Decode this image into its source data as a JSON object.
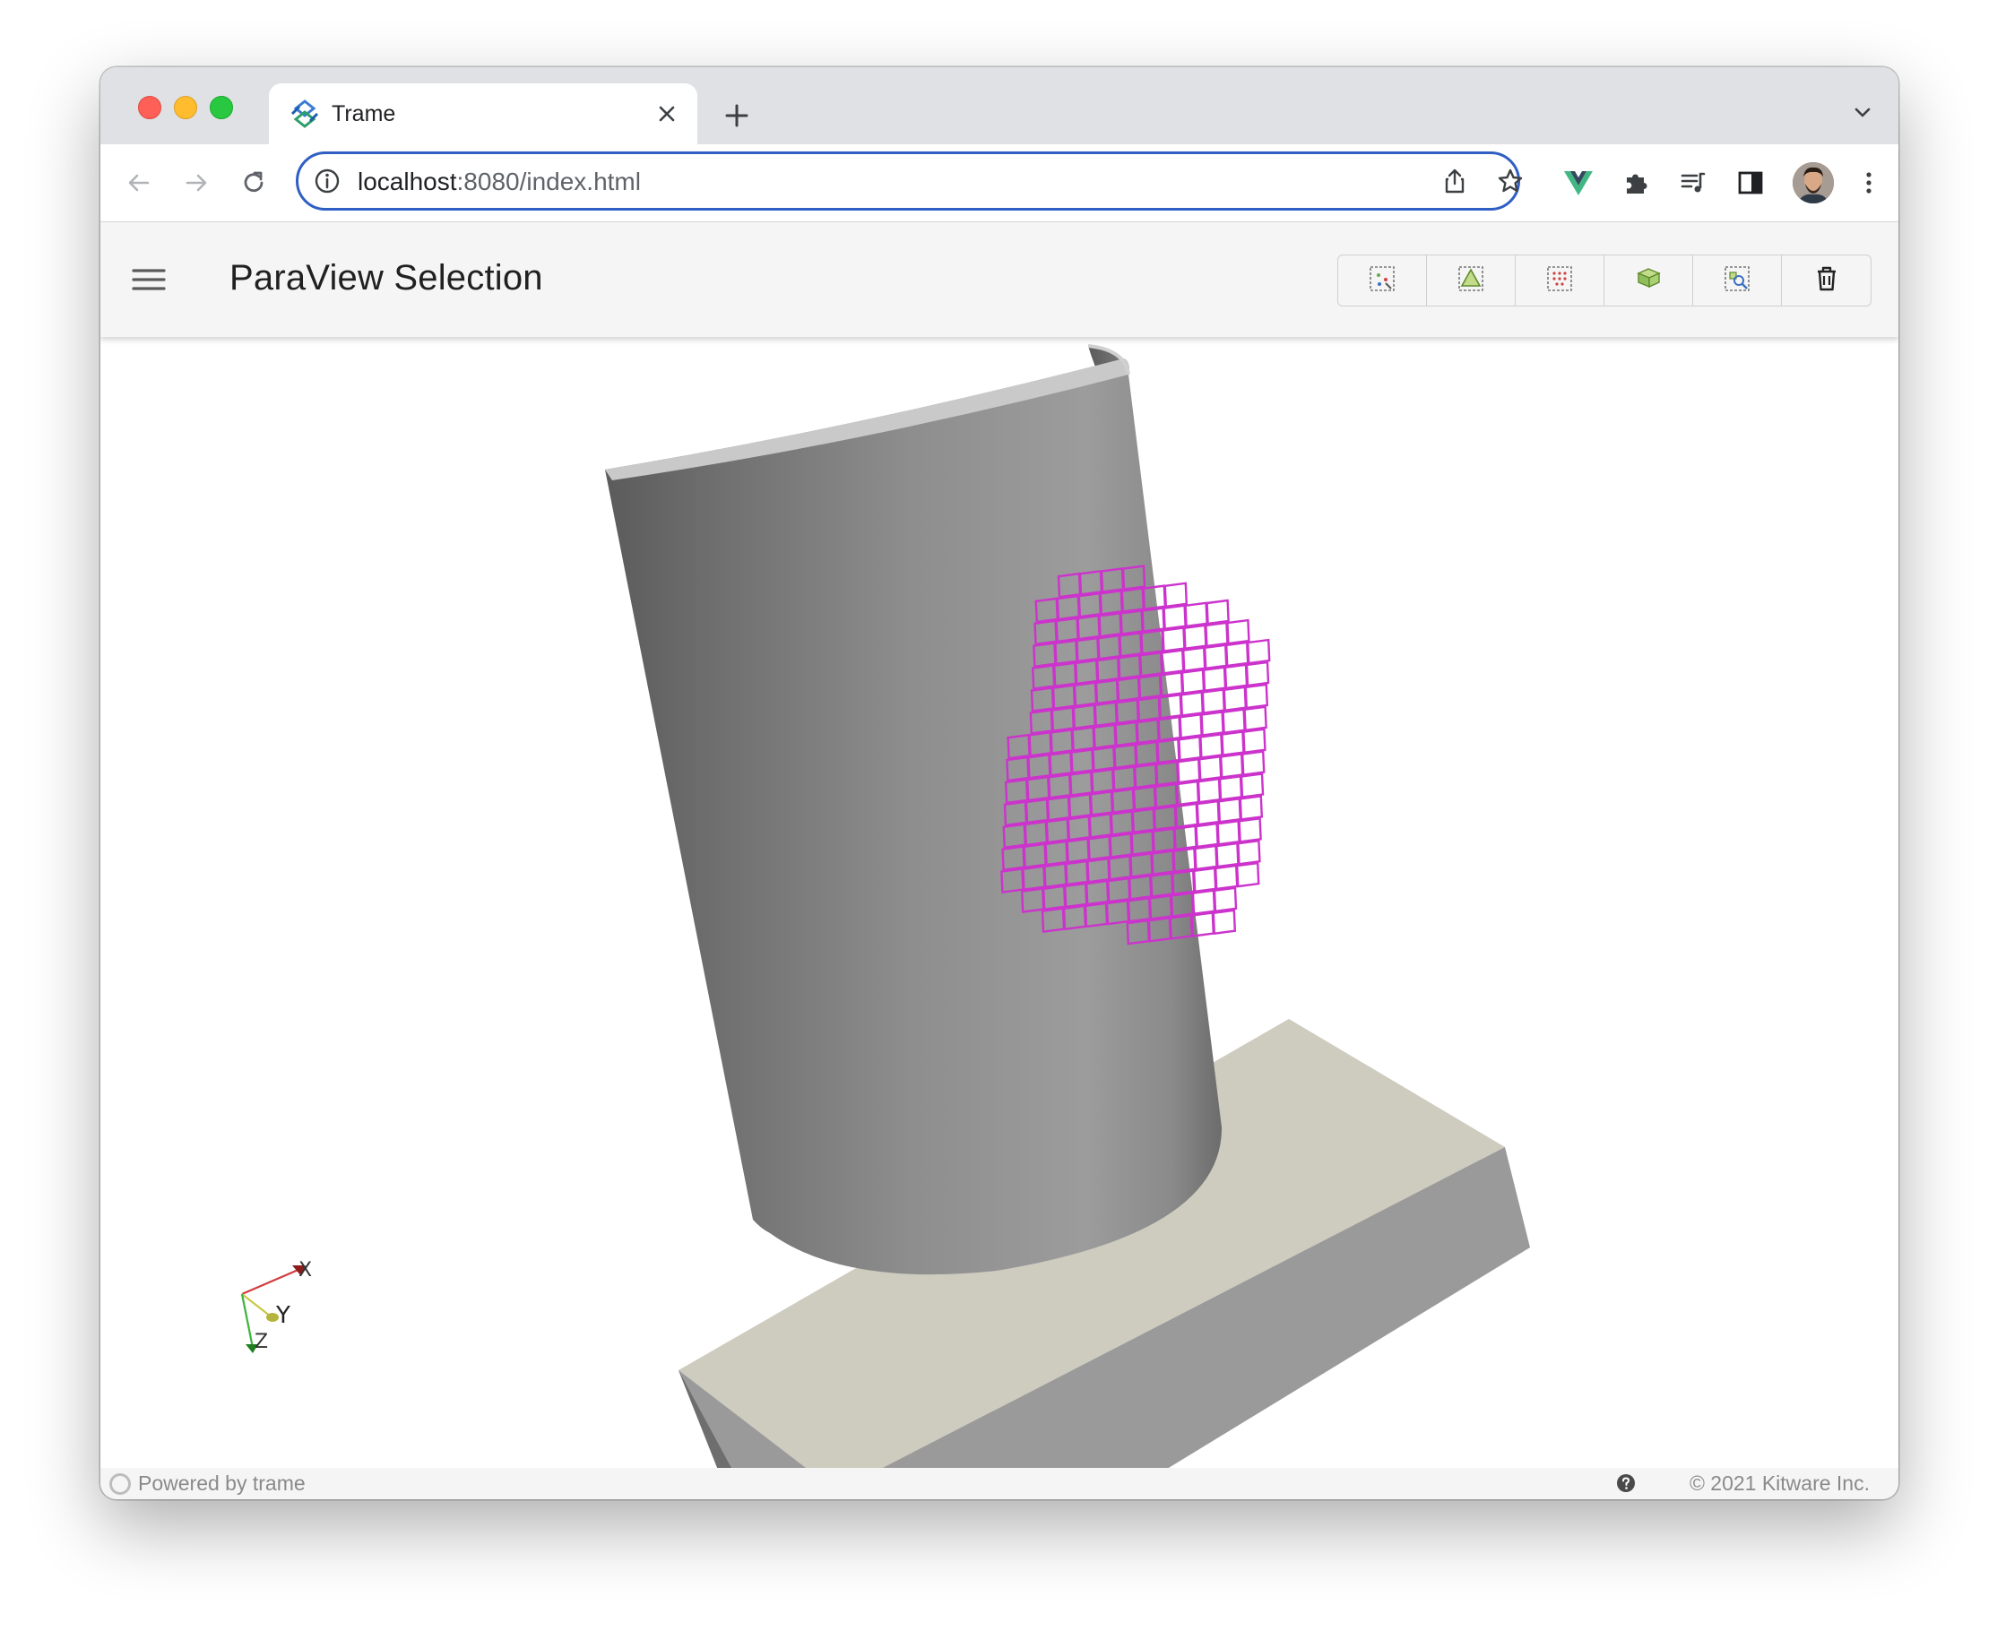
{
  "browser": {
    "tab": {
      "title": "Trame",
      "icon": "trame-logo-icon"
    },
    "url": {
      "host": "localhost",
      "rest": ":8080/index.html"
    },
    "icons": {
      "back": "arrow-left-icon",
      "forward": "arrow-right-icon",
      "reload": "reload-icon",
      "info": "info-icon",
      "share": "share-icon",
      "bookmark": "star-icon",
      "vue_devtools": "vue-icon",
      "extensions": "puzzle-icon",
      "reading_list": "media-queue-icon",
      "side_panel": "side-panel-icon",
      "profile": "avatar",
      "menu": "more-vert-icon"
    },
    "colors": {
      "tabstrip": "#dfe1e5",
      "omnibox_border": "#2f5fc4"
    }
  },
  "app": {
    "title": "ParaView Selection",
    "toolbar_buttons": [
      {
        "name": "select-surface-points-button",
        "icon": "select-points-icon"
      },
      {
        "name": "select-surface-cells-button",
        "icon": "select-cells-icon"
      },
      {
        "name": "select-points-through-button",
        "icon": "select-points-through-icon"
      },
      {
        "name": "select-cells-through-button",
        "icon": "select-cells-through-icon"
      },
      {
        "name": "select-block-button",
        "icon": "select-block-icon"
      },
      {
        "name": "clear-selection-button",
        "icon": "trash-icon"
      }
    ],
    "axes": {
      "x": "X",
      "y": "Y",
      "z": "Z"
    },
    "colors": {
      "selection": "#cc33cc",
      "surface": "#8f8f8f",
      "base": "#cecbbf"
    }
  },
  "footer": {
    "powered": "Powered by trame",
    "copyright": "© 2021 Kitware Inc."
  }
}
